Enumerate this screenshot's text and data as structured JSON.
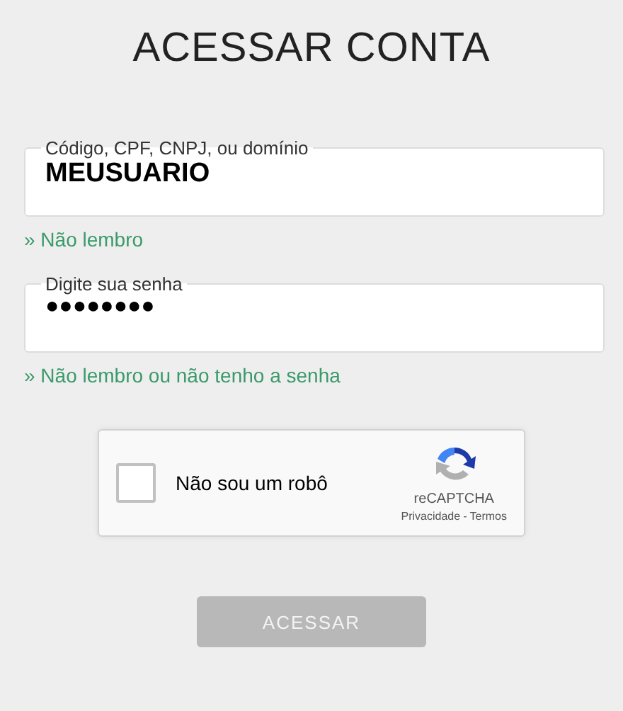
{
  "title": "ACESSAR CONTA",
  "fields": [
    {
      "label": "Código, CPF, CNPJ, ou domínio",
      "value": "MEUSUARIO",
      "kind": "text",
      "link": "» Não lembro"
    },
    {
      "label": "Digite sua senha",
      "value": "●●●●●●●●",
      "kind": "password",
      "link": "» Não lembro ou não tenho a senha"
    }
  ],
  "captcha": {
    "label": "Não sou um robô",
    "checked": false,
    "brand": "reCAPTCHA",
    "privacy": "Privacidade",
    "separator": "-",
    "terms": "Termos"
  },
  "submit": {
    "label": "ACESSAR",
    "disabled": true
  }
}
